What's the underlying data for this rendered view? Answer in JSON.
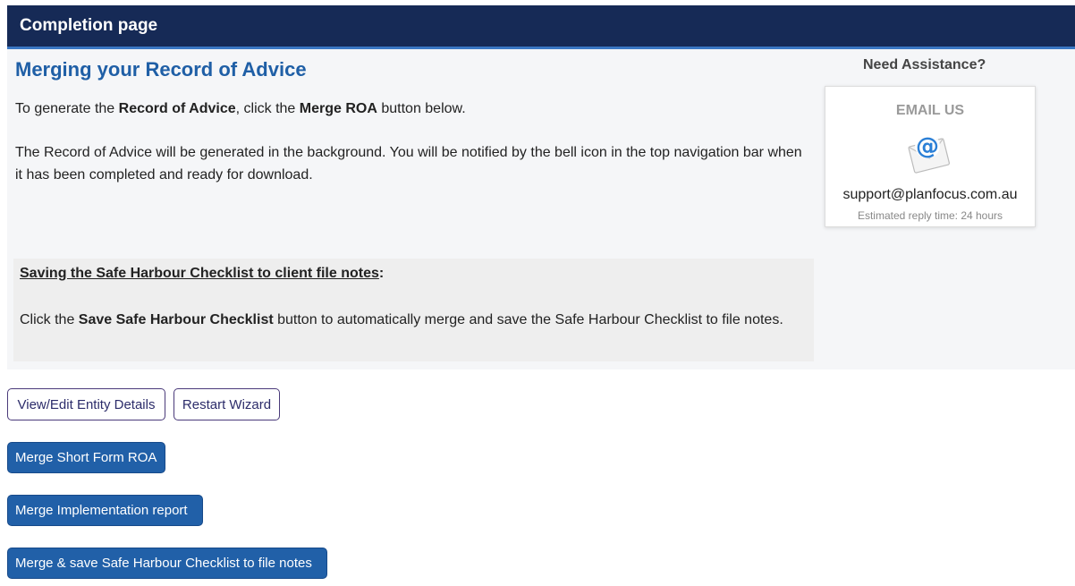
{
  "header": {
    "title": "Completion page"
  },
  "main": {
    "title": "Merging your Record of Advice",
    "paragraph1": {
      "part1": "To generate the ",
      "bold1": "Record of Advice",
      "part2": ", click the ",
      "bold2": "Merge ROA",
      "part3": " button below."
    },
    "paragraph2": "The Record of Advice will be generated in the background. You will be notified by the bell icon in the top navigation bar when it has been completed and ready for download."
  },
  "checklist": {
    "title": "Saving the Safe Harbour Checklist to client file notes",
    "title_suffix": ":",
    "body": {
      "part1": "Click the ",
      "bold": "Save Safe Harbour Checklist",
      "part2": " button to automatically merge and save the Safe Harbour Checklist to file notes."
    }
  },
  "assistance": {
    "heading": "Need Assistance?",
    "email_label": "EMAIL US",
    "email_icon": "email-at-envelope-icon",
    "email_address": "support@planfocus.com.au",
    "reply_time": "Estimated reply time: 24 hours"
  },
  "buttons": {
    "view_edit": "View/Edit Entity Details",
    "restart": "Restart Wizard",
    "merge_short": "Merge Short Form ROA",
    "merge_impl": "Merge Implementation report",
    "merge_safe": "Merge & save Safe Harbour Checklist to file notes"
  },
  "colors": {
    "header_bg": "#162a56",
    "header_accent": "#3a77c4",
    "title_blue": "#1f5fa6",
    "button_blue": "#2160a8"
  }
}
